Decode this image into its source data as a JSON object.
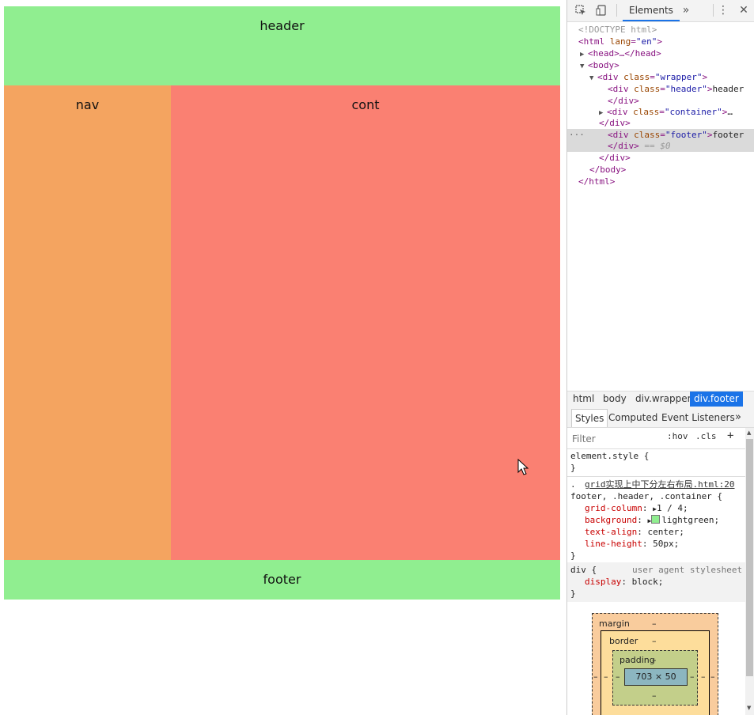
{
  "page": {
    "header": "header",
    "nav": "nav",
    "cont": "cont",
    "footer": "footer",
    "colors": {
      "header": "#90ee90",
      "nav": "#f4a460",
      "cont": "#fa8072",
      "footer": "#90ee90"
    }
  },
  "devtools": {
    "toolbar": {
      "tab": "Elements",
      "more": "»",
      "menu": "⋮",
      "close": "✕"
    },
    "dom": {
      "doctype": "<!DOCTYPE html>",
      "html_open_tag": "<html",
      "html_attr": "lang",
      "html_attr_val": "\"en\"",
      "head": "<head>…</head>",
      "body_open": "<body>",
      "wrapper_tag": "<div",
      "wrapper_attr": "class",
      "wrapper_val": "\"wrapper\"",
      "header_attr_val": "\"header\"",
      "header_text": "header",
      "container_attr_val": "\"container\"",
      "container_tail": "…",
      "footer_attr_val": "\"footer\"",
      "footer_text": "footer",
      "close_div": "</div>",
      "selected_suffix": "== $0",
      "close_body": "</body>",
      "close_html": "</html>"
    },
    "breadcrumbs": [
      "html",
      "body",
      "div.wrapper",
      "div.footer"
    ],
    "subtabs": [
      "Styles",
      "Computed",
      "Event Listeners"
    ],
    "subtabs_more": "»",
    "filter": {
      "placeholder": "Filter",
      "hov": ":hov",
      "cls": ".cls",
      "add": "+"
    },
    "styles": {
      "element_style": "element.style {",
      "close_brace": "}",
      "rule_selector_start": ".",
      "rule_source": "grid实现上中下分左右布局.html:20",
      "rule_selector": "footer, .header, .container {",
      "props": [
        {
          "name": "grid-column",
          "value": "1 / 4;"
        },
        {
          "name": "background",
          "value": "lightgreen;"
        },
        {
          "name": "text-align",
          "value": "center;"
        },
        {
          "name": "line-height",
          "value": "50px;"
        }
      ],
      "ua_selector": "div {",
      "ua_label": "user agent stylesheet",
      "ua_prop": {
        "name": "display",
        "value": "block;"
      }
    },
    "box_model": {
      "margin_label": "margin",
      "border_label": "border",
      "padding_label": "padding",
      "dash": "–",
      "content": "703 × 50"
    }
  }
}
